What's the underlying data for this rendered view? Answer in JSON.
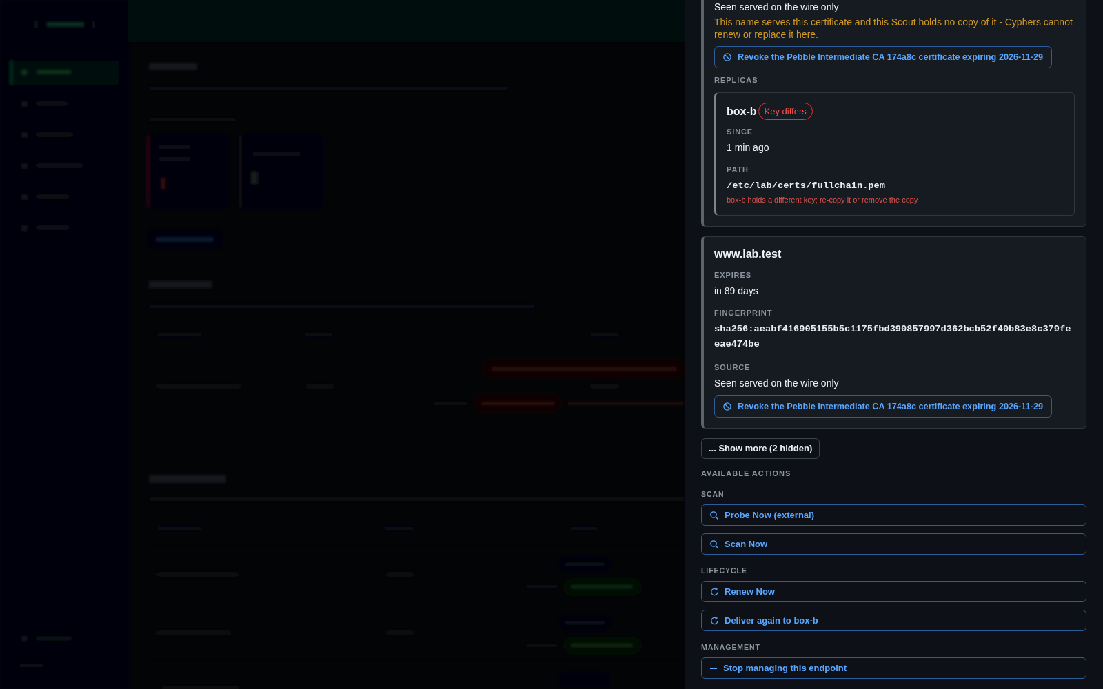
{
  "drawer": {
    "certificates": [
      {
        "fields": [
          {
            "value": "Seen served on the wire only",
            "kind": "text"
          }
        ],
        "warning": "This name serves this certificate and this Scout holds no copy of it - Cyphers cannot renew or replace it here.",
        "revoke_button": "Revoke the Pebble Intermediate CA 174a8c certificate expiring 2026-11-29",
        "replicas_heading": "REPLICAS",
        "replicas": [
          {
            "name": "box-b",
            "badge": "Key differs",
            "alert": true,
            "fields": [
              {
                "label": "SINCE",
                "value": "1 min ago",
                "kind": "text"
              },
              {
                "label": "PATH",
                "value": "/etc/lab/certs/fullchain.pem",
                "kind": "mono"
              }
            ],
            "error": "box-b holds a different key; re-copy it or remove the copy"
          }
        ]
      },
      {
        "title": "www.lab.test",
        "fields": [
          {
            "label": "EXPIRES",
            "value": "in 89 days",
            "kind": "text"
          },
          {
            "label": "FINGERPRINT",
            "value": "sha256:aeabf416905155b5c1175fbd390857997d362bcb52f40b83e8c379feeae474be",
            "kind": "mono"
          },
          {
            "label": "SOURCE",
            "value": "Seen served on the wire only",
            "kind": "text"
          }
        ],
        "revoke_button": "Revoke the Pebble Intermediate CA 174a8c certificate expiring 2026-11-29"
      }
    ],
    "show_more_button": "... Show more (2 hidden)",
    "actions_heading": "AVAILABLE ACTIONS",
    "action_groups": [
      {
        "heading": "SCAN",
        "actions": [
          {
            "label": "Probe Now (external)",
            "kind": "search"
          },
          {
            "label": "Scan Now",
            "kind": "search"
          }
        ]
      },
      {
        "heading": "LIFECYCLE",
        "actions": [
          {
            "label": "Renew Now",
            "kind": "refresh"
          },
          {
            "label": "Deliver again to box-b",
            "kind": "refresh"
          }
        ]
      },
      {
        "heading": "MANAGEMENT",
        "actions": [
          {
            "label": "Stop managing this endpoint",
            "kind": "remove"
          }
        ]
      }
    ]
  }
}
